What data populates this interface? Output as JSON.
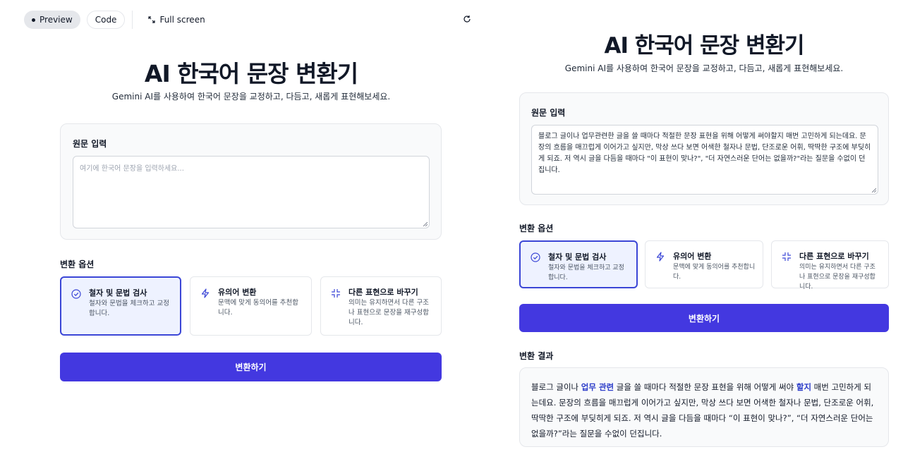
{
  "toolbar": {
    "preview": "Preview",
    "code": "Code",
    "fullscreen": "Full screen"
  },
  "icons": {
    "preview": "dot-icon",
    "fullscreen": "expand-icon",
    "refresh": "refresh-icon",
    "spelling": "check-circle-icon",
    "synonym": "lightning-icon",
    "rephrase": "shrink-arrows-icon"
  },
  "colors": {
    "primary": "#4338e0",
    "selected_border": "#3b46d6",
    "selected_bg": "#eef2ff",
    "highlight": "#2c3cc9"
  },
  "app": {
    "title": "AI 한국어 문장 변환기",
    "subtitle": "Gemini AI를 사용하여 한국어 문장을 교정하고, 다듬고, 새롭게 표현해보세요.",
    "input_label": "원문 입력",
    "input_placeholder": "여기에 한국어 문장을 입력하세요...",
    "options_label": "변환 옵션",
    "options": [
      {
        "title": "철자 및 문법 검사",
        "desc": "철자와 문법을 체크하고 교정합니다.",
        "selected": true
      },
      {
        "title": "유의어 변환",
        "desc": "문맥에 맞게 동의어를 추천합니다.",
        "selected": false
      },
      {
        "title": "다른 표현으로 바꾸기",
        "desc": "의미는 유지하면서 다른 구조나 표현으로 문장을 재구성합니다.",
        "selected": false
      }
    ],
    "submit": "변환하기",
    "result_label": "변환 결과"
  },
  "right": {
    "input_value": "블로그 글이나 업무관련한 글을 쓸 때마다 적절한 문장 표현을 위해 어떻게 써야할지 매번 고민하게 되는데요. 문장의 흐름을 매끄럽게 이어가고 싶지만, 막상 쓰다 보면 어색한 철자나 문법, 단조로운 어휘, 딱딱한 구조에 부딪히게 되죠. 저 역시 글을 다듬을 때마다 \"이 표현이 맞나?\", \"더 자연스러운 단어는 없을까?\"라는 질문을 수없이 던집니다.",
    "result": {
      "p1": "블로그 글이나 ",
      "hl1": "업무 관련",
      "p2": " 글을 쓸 때마다 적절한 문장 표현을 위해 어떻게 써야 ",
      "hl2": "할지",
      "p3": " 매번 고민하게 되는데요. 문장의 흐름을 매끄럽게 이어가고 싶지만, 막상 쓰다 보면 어색한 철자나 문법, 단조로운 어휘, 딱딱한 구조에 부딪히게 되죠. 저 역시 글을 다듬을 때마다 “이 표현이 맞나?”, “더 자연스러운 단어는 없을까?”라는 질문을 수없이 던집니다."
    }
  }
}
